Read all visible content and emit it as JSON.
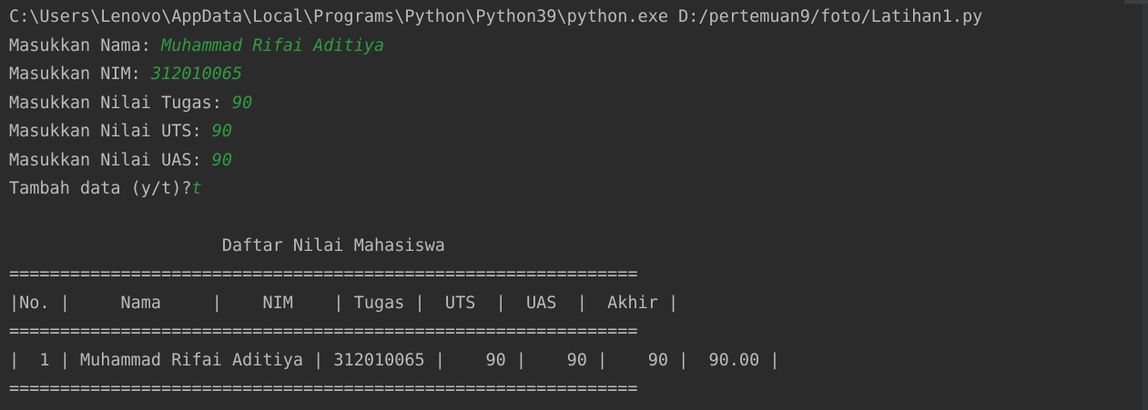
{
  "console": {
    "command_line": "C:\\Users\\Lenovo\\AppData\\Local\\Programs\\Python\\Python39\\python.exe D:/pertemuan9/foto/Latihan1.py",
    "prompts": [
      {
        "label": "Masukkan Nama: ",
        "value": "Muhammad Rifai Aditiya"
      },
      {
        "label": "Masukkan NIM: ",
        "value": "312010065"
      },
      {
        "label": "Masukkan Nilai Tugas: ",
        "value": "90"
      },
      {
        "label": "Masukkan Nilai UTS: ",
        "value": "90"
      },
      {
        "label": "Masukkan Nilai UAS: ",
        "value": "90"
      },
      {
        "label": "Tambah data (y/t)?",
        "value": "t"
      }
    ],
    "table_title": "                     Daftar Nilai Mahasiswa",
    "separator": "==============================================================",
    "table_header": "|No. |     Nama     |    NIM    | Tugas |  UTS  |  UAS  |  Akhir |",
    "table_rows": [
      "|  1 | Muhammad Rifai Aditiya | 312010065 |    90 |    90 |    90 |  90.00 |"
    ]
  },
  "colors": {
    "background": "#2b2b2b",
    "output_text": "#bbbbbb",
    "user_input": "#2f9e3d"
  }
}
